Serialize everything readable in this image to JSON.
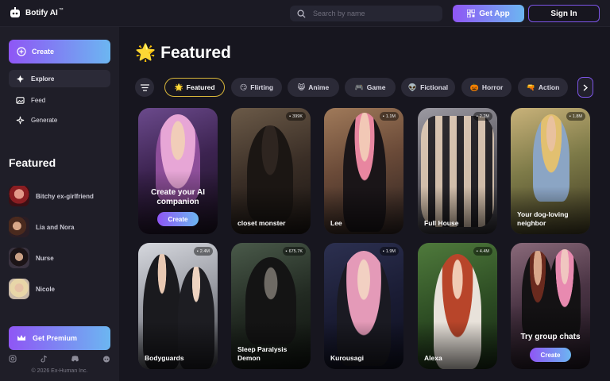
{
  "app": {
    "name": "Botify AI",
    "trademark": "™"
  },
  "search": {
    "placeholder": "Search by name"
  },
  "header": {
    "get_app_label": "Get App",
    "sign_in_label": "Sign In"
  },
  "sidebar": {
    "create_label": "Create",
    "nav": [
      {
        "label": "Explore",
        "icon": "compass-icon",
        "active": true
      },
      {
        "label": "Feed",
        "icon": "feed-icon",
        "active": false
      },
      {
        "label": "Generate",
        "icon": "sparkle-icon",
        "active": false
      }
    ],
    "featured_heading": "Featured",
    "characters": [
      {
        "name": "Bitchy ex-girlfriend"
      },
      {
        "name": "Lia and Nora"
      },
      {
        "name": "Nurse"
      },
      {
        "name": "Nicole"
      }
    ],
    "premium_label": "Get Premium",
    "socials": [
      "instagram-icon",
      "tiktok-icon",
      "discord-icon",
      "reddit-icon"
    ],
    "copyright": "© 2026 Ex-Human Inc."
  },
  "main": {
    "title": "Featured",
    "title_emoji": "🌟",
    "tabs": [
      {
        "emoji": "🌟",
        "label": "Featured",
        "active": true
      },
      {
        "emoji": "😏",
        "label": "Flirting",
        "active": false
      },
      {
        "emoji": "😸",
        "label": "Anime",
        "active": false
      },
      {
        "emoji": "🎮",
        "label": "Game",
        "active": false
      },
      {
        "emoji": "👽",
        "label": "Fictional",
        "active": false
      },
      {
        "emoji": "🎃",
        "label": "Horror",
        "active": false
      },
      {
        "emoji": "🔫",
        "label": "Action",
        "active": false
      }
    ],
    "promo_create": {
      "title": "Create your AI companion",
      "button": "Create"
    },
    "promo_group": {
      "title": "Try group chats",
      "button": "Create"
    },
    "cards": [
      {
        "name": "closet monster",
        "count": "399K"
      },
      {
        "name": "Lee",
        "count": "1.1M"
      },
      {
        "name": "Full House",
        "count": "2.2M"
      },
      {
        "name": "Your dog-loving neighbor",
        "count": "1.8M"
      },
      {
        "name": "Bodyguards",
        "count": "2.4M"
      },
      {
        "name": "Sleep Paralysis Demon",
        "count": "675.7K"
      },
      {
        "name": "Kurousagi",
        "count": "1.9M"
      },
      {
        "name": "Alexa",
        "count": "4.4M"
      }
    ]
  }
}
